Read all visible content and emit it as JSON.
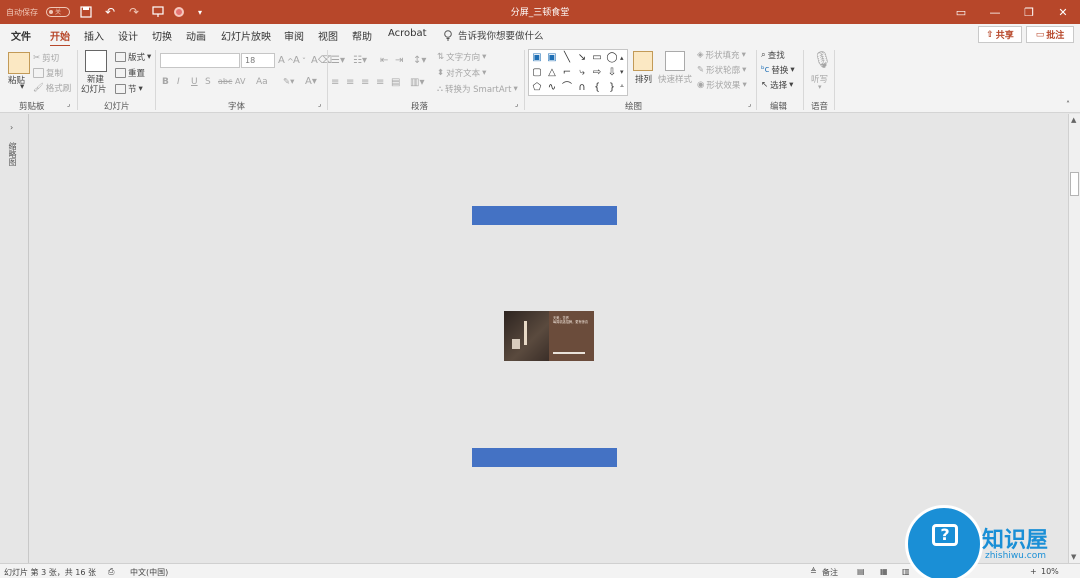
{
  "titlebar": {
    "autosave": "自动保存",
    "autosave_state": "关",
    "doc_title": "分屏_三顿食堂",
    "colors": {
      "accent": "#b7472a"
    }
  },
  "tabs": {
    "file": "文件",
    "items": [
      "开始",
      "插入",
      "设计",
      "切换",
      "动画",
      "幻灯片放映",
      "审阅",
      "视图",
      "帮助",
      "Acrobat"
    ],
    "active": "开始",
    "tellme": "告诉我你想要做什么",
    "share": "共享",
    "comments": "批注"
  },
  "ribbon": {
    "clipboard": {
      "label": "剪贴板",
      "paste": "粘贴",
      "cut": "剪切",
      "copy": "复制",
      "format_painter": "格式刷"
    },
    "slides": {
      "label": "幻灯片",
      "new_slide_1": "新建",
      "new_slide_2": "幻灯片",
      "layout": "版式",
      "reset": "重置",
      "section": "节"
    },
    "font": {
      "label": "字体",
      "font_name": "",
      "font_size": "18",
      "bold": "B",
      "italic": "I",
      "underline": "U",
      "shadow": "S",
      "strike": "abc",
      "spacing": "AV",
      "case": "Aa"
    },
    "paragraph": {
      "label": "段落",
      "text_direction": "文字方向",
      "align_text": "对齐文本",
      "smartart": "转换为 SmartArt"
    },
    "drawing": {
      "label": "绘图",
      "arrange": "排列",
      "quick_styles": "快速样式",
      "shape_fill": "形状填充",
      "shape_outline": "形状轮廓",
      "shape_effects": "形状效果"
    },
    "editing": {
      "label": "编辑",
      "find": "查找",
      "replace": "替换",
      "select": "选择"
    },
    "voice": {
      "label": "语音",
      "dictate": "听写"
    }
  },
  "thumbnails": {
    "label": "缩略图"
  },
  "slide": {
    "bar_color": "#4472c4",
    "image_title": "天美，苦荞",
    "image_subtitle": "每周精选招牌，更有惊喜"
  },
  "statusbar": {
    "slide_info": "幻灯片 第 3 张，共 16 张",
    "language": "中文(中国)",
    "notes": "备注",
    "zoom": "10%"
  },
  "watermark": {
    "name": "知识屋",
    "url": "zhishiwu.com"
  }
}
